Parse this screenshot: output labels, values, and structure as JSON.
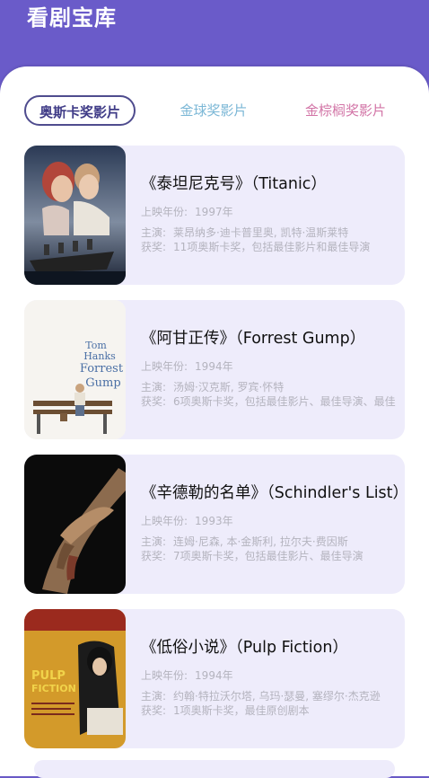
{
  "app": {
    "title": "看剧宝库"
  },
  "tabs": [
    {
      "label": "奥斯卡奖影片",
      "active": true
    },
    {
      "label": "金球奖影片",
      "active": false
    },
    {
      "label": "金棕榈奖影片",
      "active": false
    }
  ],
  "labels": {
    "year": "上映年份:",
    "cast": "主演:",
    "awards": "获奖:"
  },
  "movies": [
    {
      "title": "《泰坦尼克号》（Titanic）",
      "year": "1997年",
      "cast": "莱昂纳多·迪卡普里奥, 凯特·温斯莱特",
      "awards": "11项奥斯卡奖，包括最佳影片和最佳导演"
    },
    {
      "title": "《阿甘正传》（Forrest Gump）",
      "year": "1994年",
      "cast": "汤姆·汉克斯, 罗宾·怀特",
      "awards": "6项奥斯卡奖，包括最佳影片、最佳导演、最佳",
      "poster_text": {
        "line1": "Tom",
        "line2": "Hanks",
        "line3": "Forrest",
        "line4": "Gump"
      }
    },
    {
      "title": "《辛德勒的名单》（Schindler's List）",
      "year": "1993年",
      "cast": "连姆·尼森, 本·金斯利, 拉尔夫·费因斯",
      "awards": "7项奥斯卡奖，包括最佳影片、最佳导演"
    },
    {
      "title": "《低俗小说》（Pulp Fiction）",
      "year": "1994年",
      "cast": "约翰·特拉沃尔塔, 乌玛·瑟曼, 塞缪尔·杰克逊",
      "awards": "1项奥斯卡奖，最佳原创剧本",
      "poster_text": {
        "line1": "PULP",
        "line2": "FICTION"
      }
    }
  ],
  "colors": {
    "header": "#6A5BC9",
    "card": "#EEECFB",
    "tab_active": "#3F3B87",
    "tab_golden_globe": "#7BB7D6",
    "tab_palme": "#D274A6"
  }
}
